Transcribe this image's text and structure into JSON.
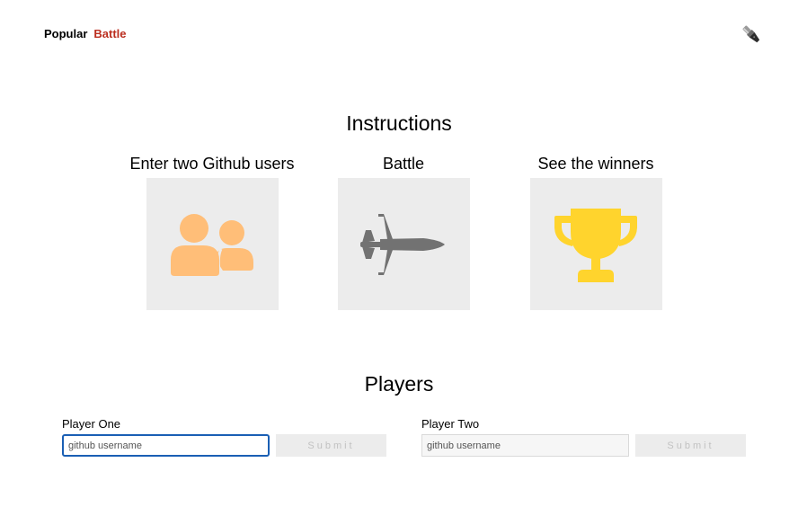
{
  "nav": {
    "items": [
      {
        "label": "Popular",
        "active": false
      },
      {
        "label": "Battle",
        "active": true
      }
    ],
    "active_color": "#bb2e1f",
    "theme_toggle_icon": "flashlight-icon"
  },
  "instructions": {
    "title": "Instructions",
    "steps": [
      {
        "title": "Enter two Github users",
        "icon": "users-icon",
        "icon_color": "#ffbe78"
      },
      {
        "title": "Battle",
        "icon": "fighter-jet-icon",
        "icon_color": "#727272"
      },
      {
        "title": "See the winners",
        "icon": "trophy-icon",
        "icon_color": "#ffd42d"
      }
    ]
  },
  "players": {
    "title": "Players",
    "player_one": {
      "label": "Player One",
      "placeholder": "github username",
      "value": "",
      "submit_label": "Submit",
      "focused": true
    },
    "player_two": {
      "label": "Player Two",
      "placeholder": "github username",
      "value": "",
      "submit_label": "Submit",
      "focused": false
    }
  }
}
